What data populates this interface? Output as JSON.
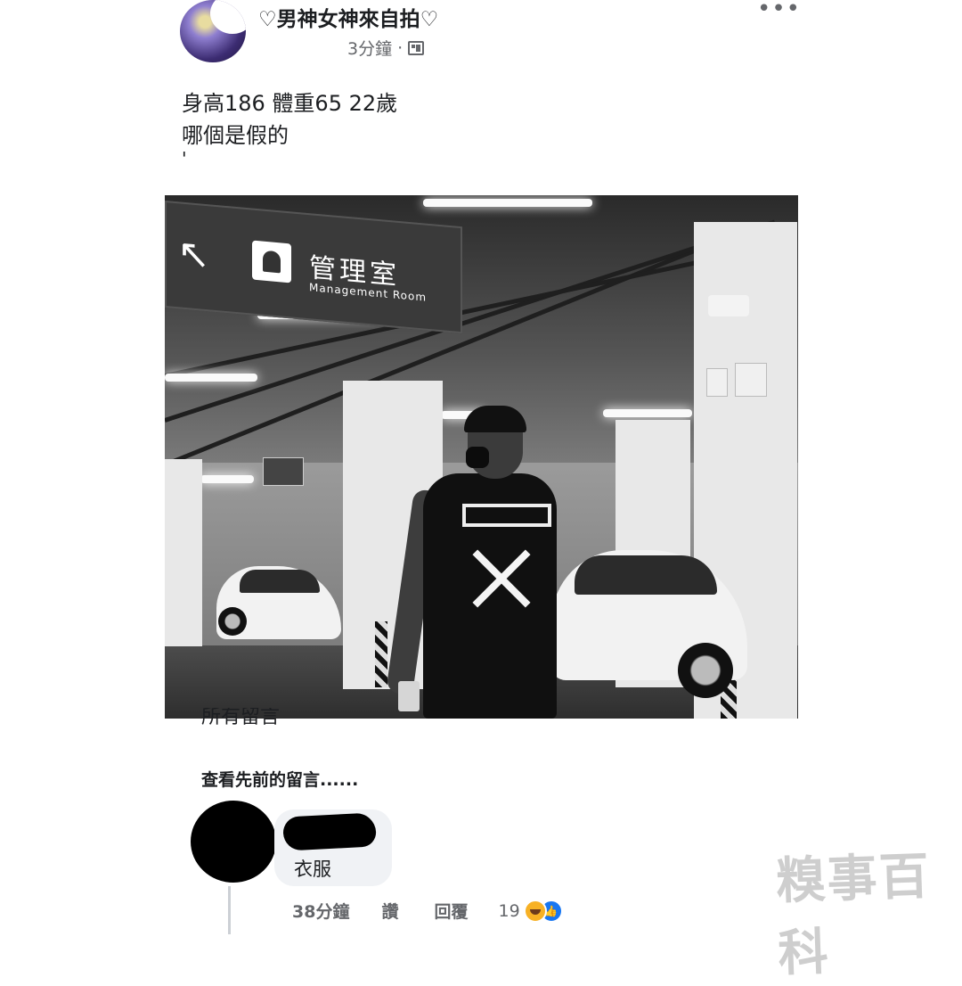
{
  "post": {
    "page_name": "♡男神女神來自拍♡",
    "time": "3分鐘",
    "separator": "·",
    "more_icon": "more-horizontal-icon",
    "audience_icon": "friends-audience-icon",
    "text_line1": "身高186 體重65 22歲",
    "text_line2": "哪個是假的",
    "text_line3": "'"
  },
  "photo": {
    "sign_arrow": "↖",
    "sign_title": "管理室",
    "sign_subtitle": "Management Room"
  },
  "comments_section": {
    "cut_off_label": "所有留言",
    "view_previous": "查看先前的留言......"
  },
  "comment": {
    "text": "衣服",
    "time": "38分鐘",
    "like_label": "讚",
    "reply_label": "回覆",
    "reaction_count": "19",
    "reaction_icons": [
      "haha-icon",
      "like-icon"
    ]
  },
  "watermark": {
    "text": "糗事百科"
  }
}
